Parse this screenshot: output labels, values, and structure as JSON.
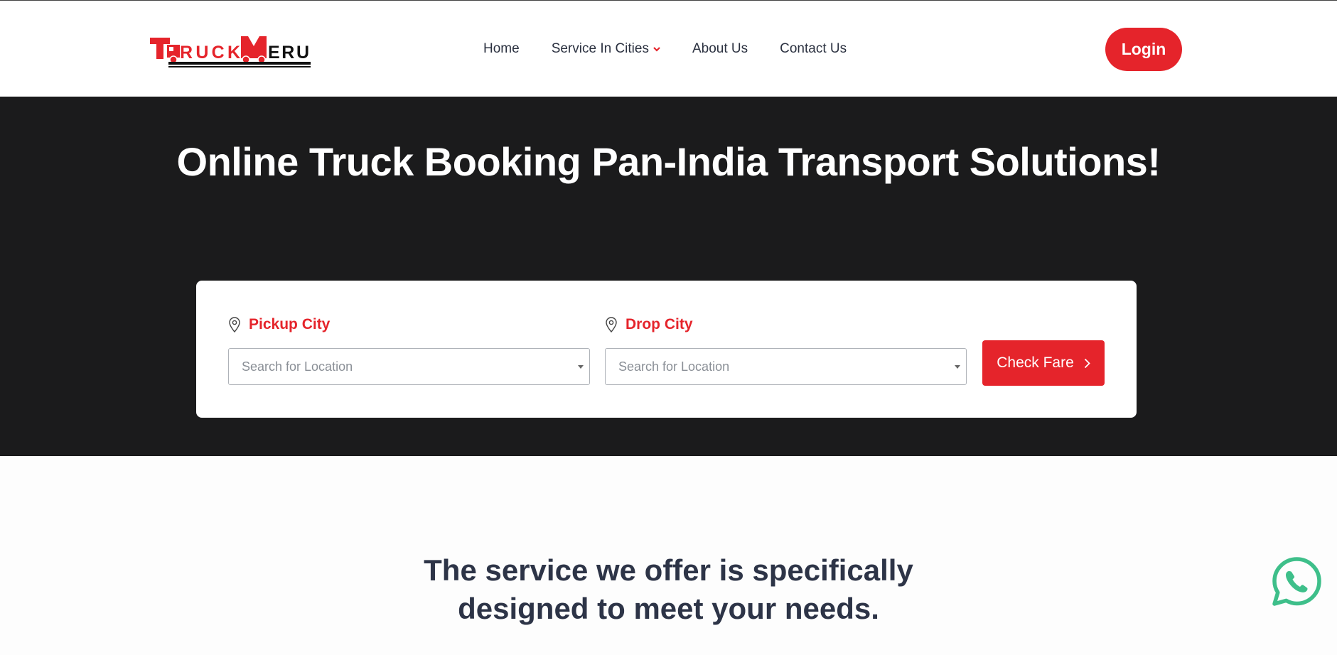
{
  "brand": {
    "logo_text": "TRUCKMERU",
    "colors": {
      "accent": "#e5242b",
      "dark": "#1b1b1c",
      "text": "#2b3140",
      "whatsapp": "#3ebf8a"
    }
  },
  "nav": {
    "items": [
      {
        "label": "Home"
      },
      {
        "label": "Service In Cities",
        "has_dropdown": true
      },
      {
        "label": "About Us"
      },
      {
        "label": "Contact Us"
      }
    ],
    "login_label": "Login"
  },
  "hero": {
    "title": "Online Truck Booking Pan-India Transport Solutions!"
  },
  "booking": {
    "pickup": {
      "label": "Pickup City",
      "placeholder": "Search for Location",
      "icon": "location-pin-icon"
    },
    "drop": {
      "label": "Drop City",
      "placeholder": "Search for Location",
      "icon": "location-pin-icon"
    },
    "submit_label": "Check Fare"
  },
  "services": {
    "title_line1": "The service we offer is specifically",
    "title_line2": "designed to meet your needs."
  },
  "floating": {
    "icon": "whatsapp-icon"
  }
}
